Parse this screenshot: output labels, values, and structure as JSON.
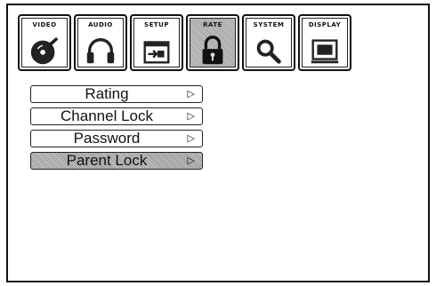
{
  "tabs": [
    {
      "label": "VIDEO",
      "icon": "video-disc-icon",
      "active": false
    },
    {
      "label": "AUDIO",
      "icon": "headphones-icon",
      "active": false
    },
    {
      "label": "SETUP",
      "icon": "setup-plug-icon",
      "active": false
    },
    {
      "label": "RATE",
      "icon": "padlock-icon",
      "active": true
    },
    {
      "label": "SYSTEM",
      "icon": "magnifier-icon",
      "active": false
    },
    {
      "label": "DISPLAY",
      "icon": "monitor-icon",
      "active": false
    }
  ],
  "menu": {
    "items": [
      {
        "label": "Rating",
        "arrow": "▷",
        "selected": false
      },
      {
        "label": "Channel Lock",
        "arrow": "▷",
        "selected": false
      },
      {
        "label": "Password",
        "arrow": "▷",
        "selected": false
      },
      {
        "label": "Parent Lock",
        "arrow": "▷",
        "selected": true
      }
    ]
  }
}
